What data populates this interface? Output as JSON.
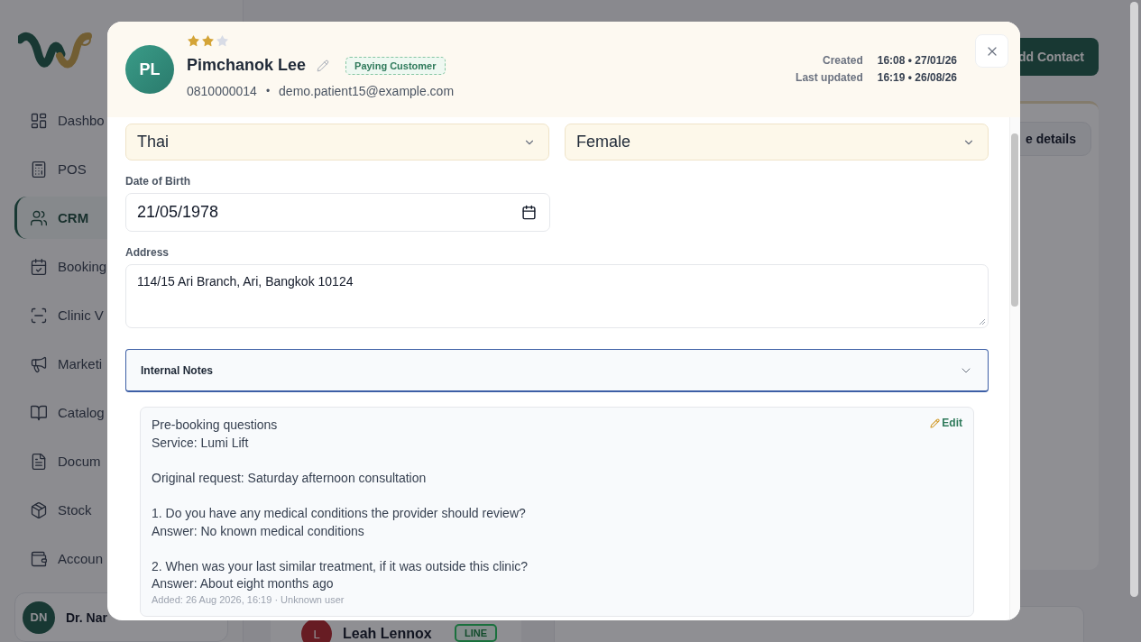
{
  "sidebar": {
    "nav": [
      {
        "kind": "dashboard",
        "label": "Dashbo",
        "selected": false
      },
      {
        "kind": "pos",
        "label": "POS",
        "selected": false
      },
      {
        "kind": "crm",
        "label": "CRM",
        "selected": true
      },
      {
        "kind": "booking",
        "label": "Booking",
        "selected": false
      },
      {
        "kind": "clinic",
        "label": "Clinic V",
        "selected": false
      },
      {
        "kind": "marketing",
        "label": "Marketi",
        "selected": false
      },
      {
        "kind": "catalog",
        "label": "Catalog",
        "selected": false
      },
      {
        "kind": "documents",
        "label": "Docum",
        "selected": false
      },
      {
        "kind": "stock",
        "label": "Stock",
        "selected": false
      },
      {
        "kind": "accounts",
        "label": "Accoun",
        "selected": false
      }
    ],
    "user": {
      "initials": "DN",
      "name": "Dr. Nar"
    }
  },
  "main": {
    "add_button": "dd Contact",
    "details_button": "e details",
    "chat": {
      "initial": "L",
      "name": "Leah Lennox",
      "channel": "LINE"
    }
  },
  "dialog": {
    "stars": 2,
    "avatar": "PL",
    "name": "Pimchanok Lee",
    "tag": "Paying Customer",
    "phone": "0810000014",
    "separator": "•",
    "email": "demo.patient15@example.com",
    "meta": [
      {
        "label": "Created",
        "value": "16:08 • 27/01/26"
      },
      {
        "label": "Last updated",
        "value": "16:19 • 26/08/26"
      }
    ],
    "fields": {
      "nationality": "Thai",
      "gender": "Female",
      "dob_label": "Date of Birth",
      "dob": "21/05/1978",
      "address_label": "Address",
      "address": "114/15 Ari Branch, Ari, Bangkok 10124"
    },
    "notes": {
      "title": "Internal Notes",
      "expanded": true,
      "edit": "Edit",
      "paragraphs": [
        "Pre-booking questions\nService: Lumi Lift",
        "Original request: Saturday afternoon consultation",
        "1. Do you have any medical conditions the provider should review?\nAnswer: No known medical conditions",
        "2. When was your last similar treatment, if it was outside this clinic?\nAnswer: About eight months ago"
      ],
      "footer": "Added: 26 Aug 2026, 16:19 · Unknown user"
    }
  }
}
